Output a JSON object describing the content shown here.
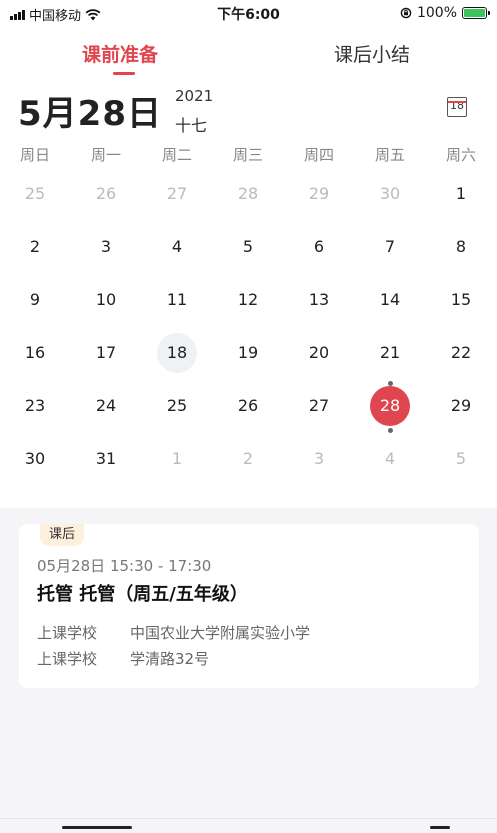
{
  "status_bar": {
    "carrier": "中国移动",
    "time": "下午6:00",
    "battery": "100%",
    "icons": [
      "signal-icon",
      "wifi-icon",
      "orientation-lock-icon",
      "battery-charging-icon"
    ]
  },
  "tabs": [
    {
      "label": "课前准备",
      "active": true
    },
    {
      "label": "课后小结",
      "active": false
    }
  ],
  "calendar": {
    "date_big": "5月28日",
    "year": "2021",
    "lunar_day": "十七",
    "calendar_icon_label": "18",
    "weekdays": [
      "周日",
      "周一",
      "周二",
      "周三",
      "周四",
      "周五",
      "周六"
    ],
    "weeks": [
      [
        "25",
        "26",
        "27",
        "28",
        "29",
        "30",
        "1"
      ],
      [
        "2",
        "3",
        "4",
        "5",
        "6",
        "7",
        "8"
      ],
      [
        "9",
        "10",
        "11",
        "12",
        "13",
        "14",
        "15"
      ],
      [
        "16",
        "17",
        "18",
        "19",
        "20",
        "21",
        "22"
      ],
      [
        "23",
        "24",
        "25",
        "26",
        "27",
        "28",
        "29"
      ],
      [
        "30",
        "31",
        "1",
        "2",
        "3",
        "4",
        "5"
      ]
    ],
    "today": "18",
    "selected": "28",
    "accent_color": "#e0464f"
  },
  "schedule": {
    "badge": "课后",
    "time": "05月28日 15:30 - 17:30",
    "title": "托管 托管（周五/五年级）",
    "rows": [
      {
        "label": "上课学校",
        "value": "中国农业大学附属实验小学"
      },
      {
        "label": "上课学校",
        "value": "学清路32号"
      }
    ]
  }
}
